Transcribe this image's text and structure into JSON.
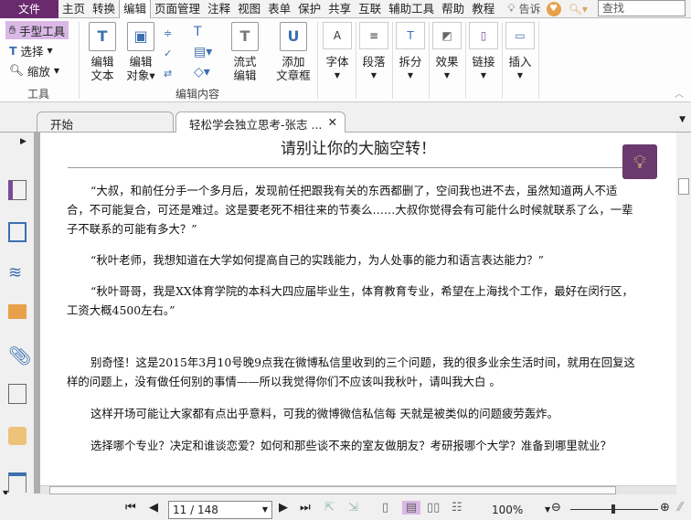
{
  "menu": {
    "file": "文件",
    "items": [
      "主页",
      "转换",
      "编辑",
      "页面管理",
      "注释",
      "视图",
      "表单",
      "保护",
      "共享",
      "互联",
      "辅助工具",
      "帮助",
      "教程"
    ],
    "active": "编辑",
    "tell": "告诉",
    "search_placeholder": "查找"
  },
  "ribbon": {
    "tools": {
      "hand": "手型工具",
      "select": "选择",
      "zoom": "缩放",
      "label": "工具"
    },
    "edit": {
      "edit_text": [
        "编辑",
        "文本"
      ],
      "edit_object": [
        "编辑",
        "对象"
      ],
      "flow_edit": [
        "流式",
        "编辑"
      ],
      "add_article": [
        "添加",
        "文章框"
      ],
      "label": "编辑内容"
    },
    "groups": [
      "字体",
      "段落",
      "拆分",
      "效果",
      "链接",
      "插入"
    ]
  },
  "tabs": [
    {
      "label": "开始"
    },
    {
      "label": "轻松学会独立思考-张志 ..."
    }
  ],
  "document": {
    "title": "请别让你的大脑空转！",
    "paragraphs": [
      "“大叔，和前任分手一个多月后，发现前任把跟我有关的东西都删了，空间我也进不去，虽然知道两人不适合，不可能复合，可还是难过。这是要老死不相往来的节奏么……大叔你觉得会有可能什么时候就联系了么，一辈子不联系的可能有多大？”",
      "“秋叶老师，我想知道在大学如何提高自己的实践能力，为人处事的能力和语言表达能力？”",
      "“秋叶哥哥，我是XX体育学院的本科大四应届毕业生，体育教育专业，希望在上海找个工作，最好在闵行区，工资大概4500左右。”",
      "别奇怪！这是2015年3月10号晚9点我在微博私信里收到的三个问题，我的很多业余生活时间，就用在回复这样的问题上，没有做任何别的事情——所以我觉得你们不应该叫我秋叶，请叫我大白 。",
      "这样开场可能让大家都有点出乎意料，可我的微博微信私信每 天就是被类似的问题疲劳轰炸。",
      "选择哪个专业？决定和谁谈恋爱？如何和那些谈不来的室友做朋友？考研报哪个大学？准备到哪里就业？"
    ]
  },
  "status": {
    "page": "11 / 148",
    "zoom": "100%"
  }
}
